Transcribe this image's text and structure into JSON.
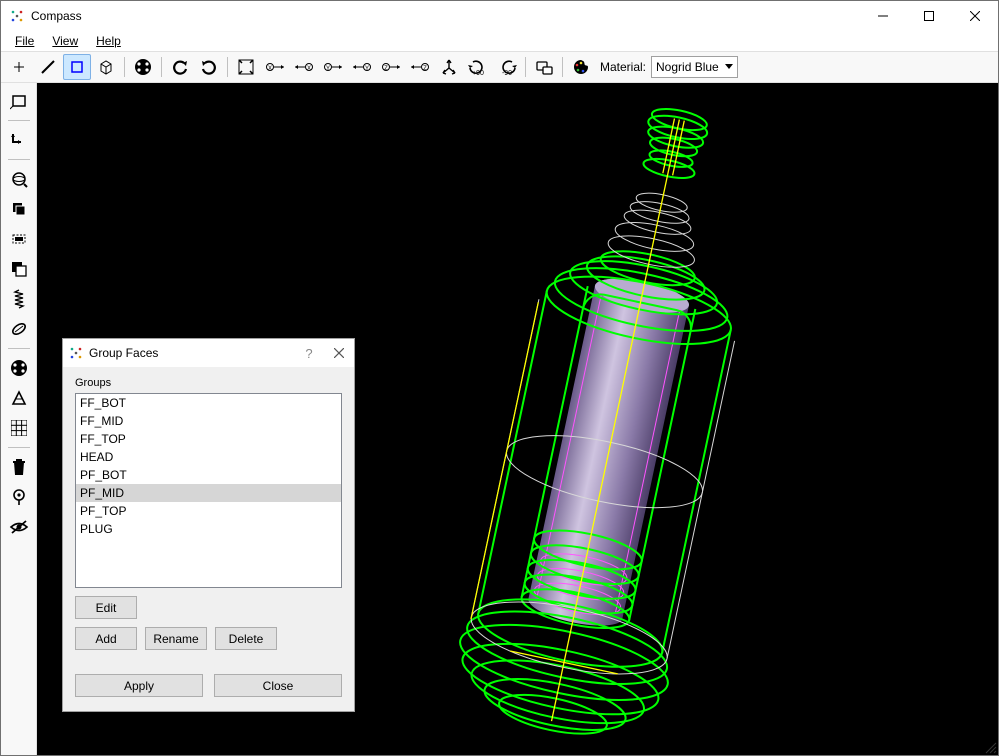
{
  "window": {
    "title": "Compass"
  },
  "menu": {
    "file": "File",
    "view": "View",
    "help": "Help"
  },
  "toolbar": {
    "material_label": "Material:",
    "material_value": "Nogrid Blue"
  },
  "dialog": {
    "title": "Group Faces",
    "groups_label": "Groups",
    "items": [
      "FF_BOT",
      "FF_MID",
      "FF_TOP",
      "HEAD",
      "PF_BOT",
      "PF_MID",
      "PF_TOP",
      "PLUG"
    ],
    "selected_index": 5,
    "edit_label": "Edit",
    "add_label": "Add",
    "rename_label": "Rename",
    "delete_label": "Delete",
    "apply_label": "Apply",
    "close_label": "Close"
  }
}
